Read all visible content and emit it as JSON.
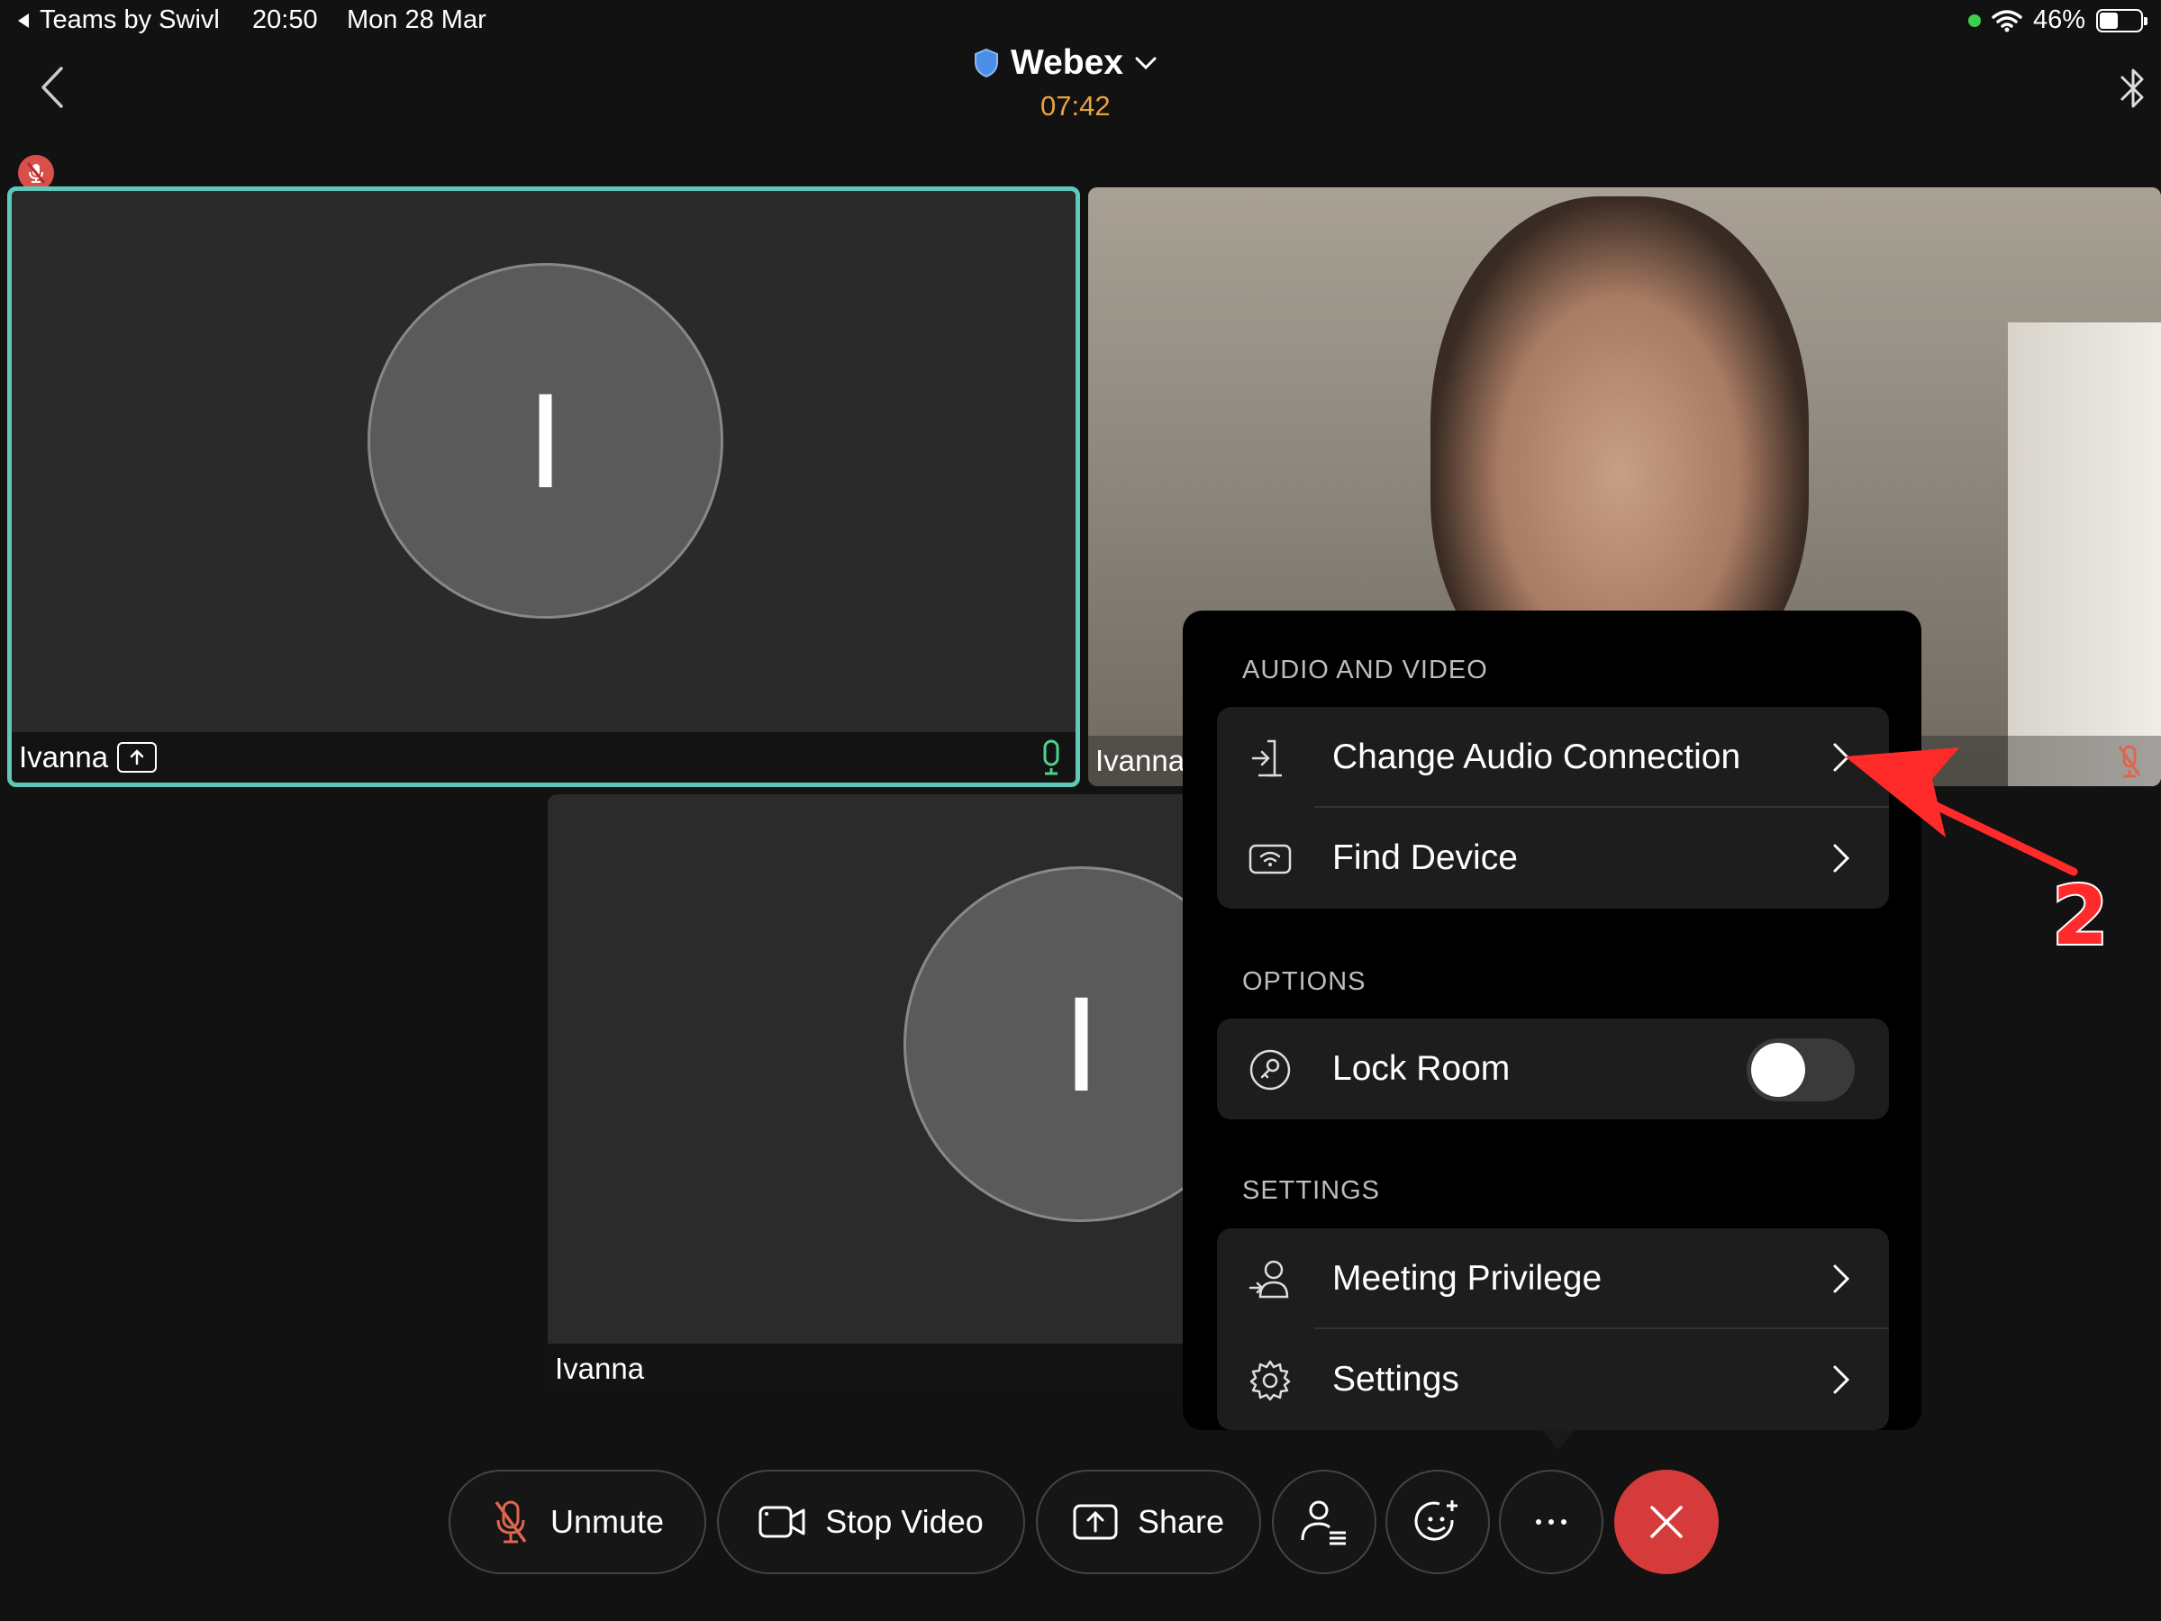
{
  "status_bar": {
    "back_app": "Teams by Swivl",
    "time": "20:50",
    "date": "Mon 28 Mar",
    "battery": "46%",
    "battery_level": 0.46
  },
  "header": {
    "title": "Webex",
    "timer": "07:42"
  },
  "tiles": [
    {
      "avatar_initial": "I",
      "name": "Ivanna"
    },
    {
      "name": "Ivanna"
    },
    {
      "avatar_initial": "I",
      "name": "Ivanna"
    }
  ],
  "popover": {
    "audio_video": {
      "title": "AUDIO AND VIDEO",
      "items": [
        {
          "label": "Change Audio Connection"
        },
        {
          "label": "Find Device"
        }
      ]
    },
    "options": {
      "title": "OPTIONS",
      "items": [
        {
          "label": "Lock Room",
          "toggle_on": false
        }
      ]
    },
    "settings": {
      "title": "SETTINGS",
      "items": [
        {
          "label": "Meeting Privilege"
        },
        {
          "label": "Settings"
        }
      ]
    }
  },
  "annotation": {
    "step": "2",
    "color": "#ff2b2b"
  },
  "controls": {
    "unmute": "Unmute",
    "stop_video": "Stop Video",
    "share": "Share"
  },
  "colors": {
    "accent_active_border": "#5fc8b9",
    "timer": "#e8a33d",
    "end_call": "#d63b3b",
    "muted_red": "#d9504b"
  }
}
